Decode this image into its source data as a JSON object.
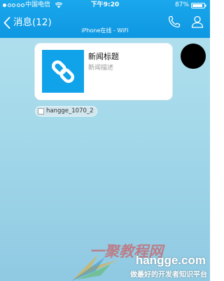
{
  "status_bar": {
    "carrier": "中国电信",
    "time": "下午9:20",
    "battery": "87%"
  },
  "nav": {
    "back_label": "消息(12)",
    "subtitle": "iPhone在线 - WiFi",
    "icons": [
      "chevron-left-icon",
      "phone-icon",
      "person-icon"
    ]
  },
  "message": {
    "title": "新闻标题",
    "description": "新闻描述",
    "thumbnail_icon": "link-icon",
    "accent_color": "#11a3ea"
  },
  "read_receipt": {
    "label": "hangge_1070_2"
  },
  "watermark": {
    "brand_chars": "一聚教程网",
    "domain": "hangge.com",
    "slogan": "做最好的开发者知识平台"
  },
  "colors": {
    "header": "#1aa7ec",
    "background": "#a4d9ea",
    "avatar": "#000000"
  }
}
